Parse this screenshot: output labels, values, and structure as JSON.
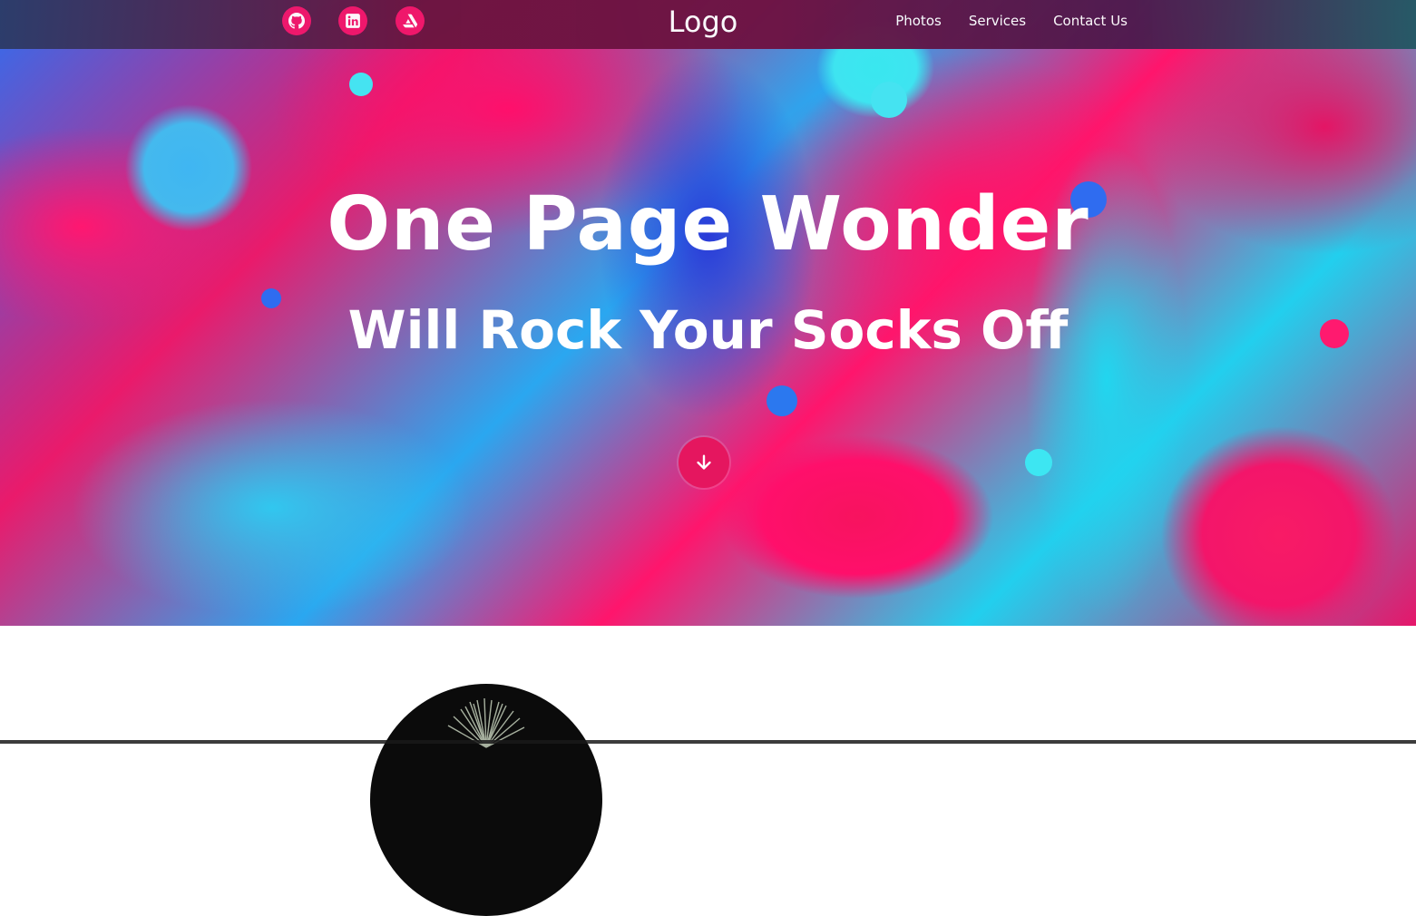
{
  "nav": {
    "logo": "Logo",
    "social": [
      {
        "icon": "github-icon"
      },
      {
        "icon": "linkedin-icon"
      },
      {
        "icon": "artstation-icon"
      }
    ],
    "links": [
      "Photos",
      "Services",
      "Contact Us"
    ]
  },
  "hero": {
    "title": "One Page Wonder",
    "subtitle": "Will Rock Your Socks Off",
    "scroll_icon": "arrow-down-icon"
  },
  "colors": {
    "accent": "#f1176b",
    "text": "#ffffff"
  }
}
